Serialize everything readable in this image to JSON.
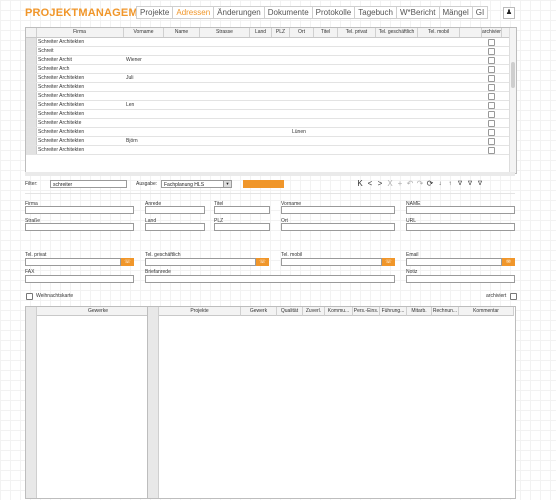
{
  "app": {
    "title": "PROJEKTMANAGEMENT"
  },
  "nav": {
    "tabs": [
      "Projekte",
      "Adressen",
      "Änderungen",
      "Dokumente",
      "Protokolle",
      "Tagebuch",
      "W*Bericht",
      "Mängel",
      "GI"
    ],
    "active_index": 1
  },
  "user_icon": "person-icon",
  "addresses_table": {
    "columns": [
      "Firma",
      "Vorname",
      "Name",
      "Strasse",
      "Land",
      "PLZ",
      "Ort",
      "Titel",
      "Tel. privat",
      "Tel. geschäftlich",
      "Tel. mobil",
      "",
      "archiviert"
    ],
    "rows": [
      {
        "firma": "Schreiter Architekten",
        "vorname": "",
        "ort": ""
      },
      {
        "firma": "Schreit",
        "vorname": "",
        "ort": ""
      },
      {
        "firma": "Schreiter Archit",
        "vorname": "Wiener",
        "ort": ""
      },
      {
        "firma": "Schreiter Arch",
        "vorname": "",
        "ort": ""
      },
      {
        "firma": "Schreiter Architekten",
        "vorname": "Juli",
        "ort": ""
      },
      {
        "firma": "Schreiter Architekten",
        "vorname": "",
        "ort": ""
      },
      {
        "firma": "Schreiter Architekten",
        "vorname": "",
        "ort": ""
      },
      {
        "firma": "Schreiter Architekten",
        "vorname": "Len",
        "ort": ""
      },
      {
        "firma": "Schreiter Architekten",
        "vorname": "",
        "ort": ""
      },
      {
        "firma": "Schreiter Architekte",
        "vorname": "",
        "ort": ""
      },
      {
        "firma": "Schreiter Architekten",
        "vorname": "",
        "ort": "Lünen"
      },
      {
        "firma": "Schreiter Architekten",
        "vorname": "Björn",
        "ort": ""
      },
      {
        "firma": "Schreiter Architekten",
        "vorname": "",
        "ort": ""
      }
    ]
  },
  "filter": {
    "label": "Filter:",
    "value": "schreiter",
    "output_label": "Ausgabe:",
    "output_value": "Fachplanung HLS",
    "export_label": ""
  },
  "toolbar": {
    "icons": [
      "first-icon",
      "prev-icon",
      "next-icon",
      "last-icon",
      "add-icon",
      "undo-icon",
      "redo-icon",
      "refresh-icon",
      "sort-asc-icon",
      "sort-desc-icon",
      "filter-icon",
      "filter-clear-icon",
      "filter-active-icon"
    ],
    "glyphs": [
      "K",
      "<",
      ">",
      "X",
      "+",
      "↶",
      "↷",
      "⟳",
      "↓",
      "↑",
      "∇",
      "∇",
      "∇"
    ]
  },
  "form": {
    "firma": {
      "label": "Firma",
      "value": ""
    },
    "anrede": {
      "label": "Anrede",
      "value": ""
    },
    "titel": {
      "label": "Titel",
      "value": ""
    },
    "vorname": {
      "label": "Vorname",
      "value": ""
    },
    "name": {
      "label": "NAME",
      "value": ""
    },
    "strasse": {
      "label": "Straße",
      "value": ""
    },
    "land": {
      "label": "Land",
      "value": ""
    },
    "plz": {
      "label": "PLZ",
      "value": ""
    },
    "ort": {
      "label": "Ort",
      "value": ""
    },
    "url": {
      "label": "URL",
      "value": ""
    },
    "tel_privat": {
      "label": "Tel. privat",
      "value": ""
    },
    "tel_geschaeftlich": {
      "label": "Tel. geschäftlich",
      "value": ""
    },
    "tel_mobil": {
      "label": "Tel. mobil",
      "value": ""
    },
    "email": {
      "label": "Email",
      "value": ""
    },
    "fax": {
      "label": "FAX",
      "value": ""
    },
    "briefanrede": {
      "label": "Briefanrede",
      "value": ""
    },
    "notiz": {
      "label": "Notiz",
      "value": ""
    },
    "weihnachtskarte": {
      "label": "Weihnachtskarte",
      "checked": false
    },
    "archiviert": {
      "label": "archiviert",
      "checked": false
    }
  },
  "gewerke_table": {
    "columns": [
      "Gewerke"
    ]
  },
  "projekte_table": {
    "columns": [
      "Projekte",
      "Gewerk",
      "Qualität",
      "Zuverl.",
      "Kommu...",
      "Pers.-Eins.",
      "Führung...",
      "Mitarb.",
      "Rechnun...",
      "Kommentar"
    ]
  },
  "colors": {
    "accent": "#f0962a",
    "border": "#bdbdbd"
  }
}
